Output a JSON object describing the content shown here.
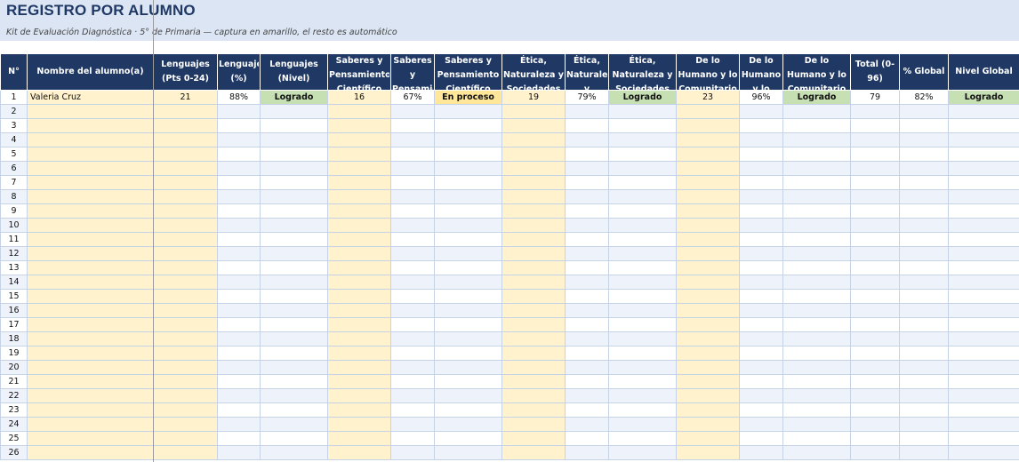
{
  "sheet": {
    "title": "REGISTRO POR ALUMNO",
    "subtitle": "Kit de Evaluación Diagnóstica · 5° de Primaria — captura en amarillo, el resto es automático"
  },
  "table": {
    "columns": [
      {
        "label": "N°",
        "input": false
      },
      {
        "label": "Nombre del alumno(a)",
        "input": true
      },
      {
        "label": "Lenguajes (Pts 0-24)",
        "input": true
      },
      {
        "label": "Lenguajes (%)",
        "input": false
      },
      {
        "label": "Lenguajes (Nivel)",
        "input": false
      },
      {
        "label": "Saberes y Pensamiento Científico (Pts",
        "input": true
      },
      {
        "label": "Saberes y Pensamiento",
        "input": false
      },
      {
        "label": "Saberes y Pensamiento Científico",
        "input": false
      },
      {
        "label": "Ética, Naturaleza y Sociedades",
        "input": true
      },
      {
        "label": "Ética, Naturaleza y",
        "input": false
      },
      {
        "label": "Ética, Naturaleza y Sociedades",
        "input": false
      },
      {
        "label": "De lo Humano y lo Comunitario",
        "input": true
      },
      {
        "label": "De lo Humano y lo",
        "input": false
      },
      {
        "label": "De lo Humano y lo Comunitario",
        "input": false
      },
      {
        "label": "Total (0-96)",
        "input": false
      },
      {
        "label": "% Global",
        "input": false
      },
      {
        "label": "Nivel Global",
        "input": false
      }
    ],
    "level_colors": {
      "Logrado": "#c6e0b4",
      "En proceso": "#ffe699"
    },
    "input_color": "#fff2cc",
    "header_color": "#1f3864",
    "rows": [
      [
        "1",
        "Valeria Cruz",
        "21",
        "88%",
        "Logrado",
        "16",
        "67%",
        "En proceso",
        "19",
        "79%",
        "Logrado",
        "23",
        "96%",
        "Logrado",
        "79",
        "82%",
        "Logrado"
      ],
      [
        "2",
        "",
        "",
        "",
        "",
        "",
        "",
        "",
        "",
        "",
        "",
        "",
        "",
        "",
        "",
        "",
        ""
      ],
      [
        "3",
        "",
        "",
        "",
        "",
        "",
        "",
        "",
        "",
        "",
        "",
        "",
        "",
        "",
        "",
        "",
        ""
      ],
      [
        "4",
        "",
        "",
        "",
        "",
        "",
        "",
        "",
        "",
        "",
        "",
        "",
        "",
        "",
        "",
        "",
        ""
      ],
      [
        "5",
        "",
        "",
        "",
        "",
        "",
        "",
        "",
        "",
        "",
        "",
        "",
        "",
        "",
        "",
        "",
        ""
      ],
      [
        "6",
        "",
        "",
        "",
        "",
        "",
        "",
        "",
        "",
        "",
        "",
        "",
        "",
        "",
        "",
        "",
        ""
      ],
      [
        "7",
        "",
        "",
        "",
        "",
        "",
        "",
        "",
        "",
        "",
        "",
        "",
        "",
        "",
        "",
        "",
        ""
      ],
      [
        "8",
        "",
        "",
        "",
        "",
        "",
        "",
        "",
        "",
        "",
        "",
        "",
        "",
        "",
        "",
        "",
        ""
      ],
      [
        "9",
        "",
        "",
        "",
        "",
        "",
        "",
        "",
        "",
        "",
        "",
        "",
        "",
        "",
        "",
        "",
        ""
      ],
      [
        "10",
        "",
        "",
        "",
        "",
        "",
        "",
        "",
        "",
        "",
        "",
        "",
        "",
        "",
        "",
        "",
        ""
      ],
      [
        "11",
        "",
        "",
        "",
        "",
        "",
        "",
        "",
        "",
        "",
        "",
        "",
        "",
        "",
        "",
        "",
        ""
      ],
      [
        "12",
        "",
        "",
        "",
        "",
        "",
        "",
        "",
        "",
        "",
        "",
        "",
        "",
        "",
        "",
        "",
        ""
      ],
      [
        "13",
        "",
        "",
        "",
        "",
        "",
        "",
        "",
        "",
        "",
        "",
        "",
        "",
        "",
        "",
        "",
        ""
      ],
      [
        "14",
        "",
        "",
        "",
        "",
        "",
        "",
        "",
        "",
        "",
        "",
        "",
        "",
        "",
        "",
        "",
        ""
      ],
      [
        "15",
        "",
        "",
        "",
        "",
        "",
        "",
        "",
        "",
        "",
        "",
        "",
        "",
        "",
        "",
        "",
        ""
      ],
      [
        "16",
        "",
        "",
        "",
        "",
        "",
        "",
        "",
        "",
        "",
        "",
        "",
        "",
        "",
        "",
        "",
        ""
      ],
      [
        "17",
        "",
        "",
        "",
        "",
        "",
        "",
        "",
        "",
        "",
        "",
        "",
        "",
        "",
        "",
        "",
        ""
      ],
      [
        "18",
        "",
        "",
        "",
        "",
        "",
        "",
        "",
        "",
        "",
        "",
        "",
        "",
        "",
        "",
        "",
        ""
      ],
      [
        "19",
        "",
        "",
        "",
        "",
        "",
        "",
        "",
        "",
        "",
        "",
        "",
        "",
        "",
        "",
        "",
        ""
      ],
      [
        "20",
        "",
        "",
        "",
        "",
        "",
        "",
        "",
        "",
        "",
        "",
        "",
        "",
        "",
        "",
        "",
        ""
      ],
      [
        "21",
        "",
        "",
        "",
        "",
        "",
        "",
        "",
        "",
        "",
        "",
        "",
        "",
        "",
        "",
        "",
        ""
      ],
      [
        "22",
        "",
        "",
        "",
        "",
        "",
        "",
        "",
        "",
        "",
        "",
        "",
        "",
        "",
        "",
        "",
        ""
      ],
      [
        "23",
        "",
        "",
        "",
        "",
        "",
        "",
        "",
        "",
        "",
        "",
        "",
        "",
        "",
        "",
        "",
        ""
      ],
      [
        "24",
        "",
        "",
        "",
        "",
        "",
        "",
        "",
        "",
        "",
        "",
        "",
        "",
        "",
        "",
        "",
        ""
      ],
      [
        "25",
        "",
        "",
        "",
        "",
        "",
        "",
        "",
        "",
        "",
        "",
        "",
        "",
        "",
        "",
        "",
        ""
      ],
      [
        "26",
        "",
        "",
        "",
        "",
        "",
        "",
        "",
        "",
        "",
        "",
        "",
        "",
        "",
        "",
        "",
        ""
      ]
    ]
  }
}
